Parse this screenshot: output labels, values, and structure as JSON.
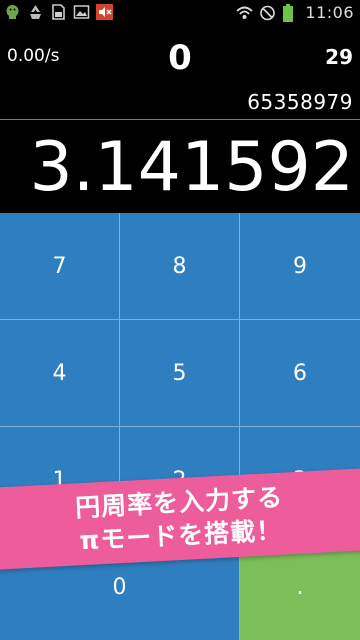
{
  "status_bar": {
    "time": "11:06",
    "left_icons": [
      "android-icon",
      "recycle-icon",
      "sd-card-icon",
      "image-icon",
      "mute-icon"
    ],
    "right_icons": [
      "wifi-icon",
      "no-signal-icon",
      "battery-icon"
    ]
  },
  "info": {
    "rate": "0.00/s",
    "score": "0",
    "count": "29",
    "digits": "65358979"
  },
  "display": {
    "value": "3.141592"
  },
  "keypad": {
    "keys": [
      "7",
      "8",
      "9",
      "4",
      "5",
      "6",
      "1",
      "2",
      "3",
      "0",
      "."
    ]
  },
  "banner": {
    "line1": "円周率を入力する",
    "line2": "πモードを搭載！"
  },
  "colors": {
    "keypad_blue": "#2f7ebf",
    "key_green": "#7cbf5a",
    "banner_pink": "#ee5d9b"
  }
}
